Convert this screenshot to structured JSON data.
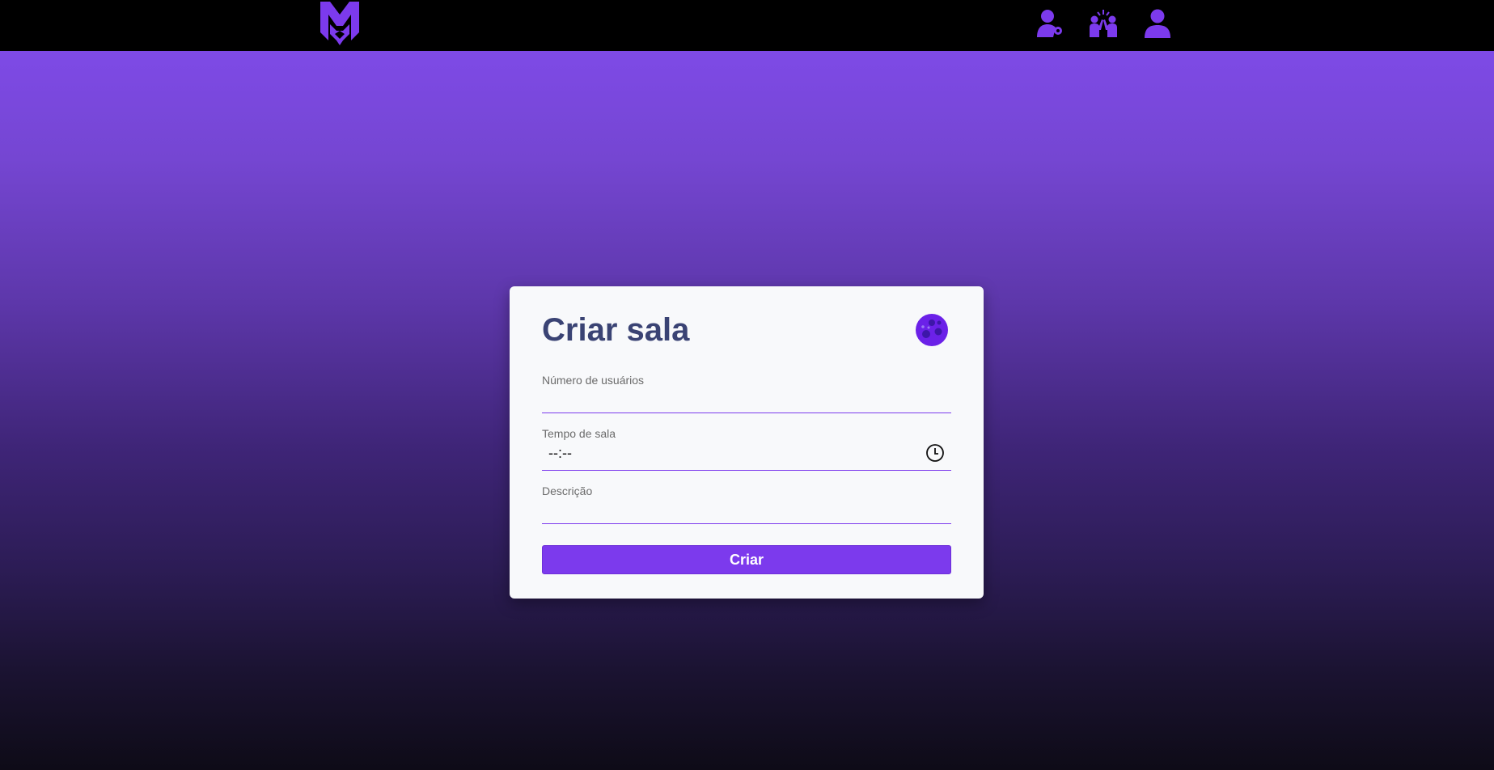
{
  "header": {
    "logo_icon": "mx-wolf-logo-icon",
    "nav_icons": [
      "user-key-icon",
      "group-highfive-icon",
      "user-profile-icon"
    ],
    "accent_color": "#7c3aed"
  },
  "form": {
    "title": "Criar sala",
    "theme_icon": "moon-icon",
    "users_label": "Número de usuários",
    "users_value": "",
    "time_label": "Tempo de sala",
    "time_value": "--:--",
    "time_icon": "clock-icon",
    "description_label": "Descrição",
    "description_value": "",
    "submit_label": "Criar",
    "title_color": "#3a4374",
    "button_color": "#7c3aed"
  }
}
